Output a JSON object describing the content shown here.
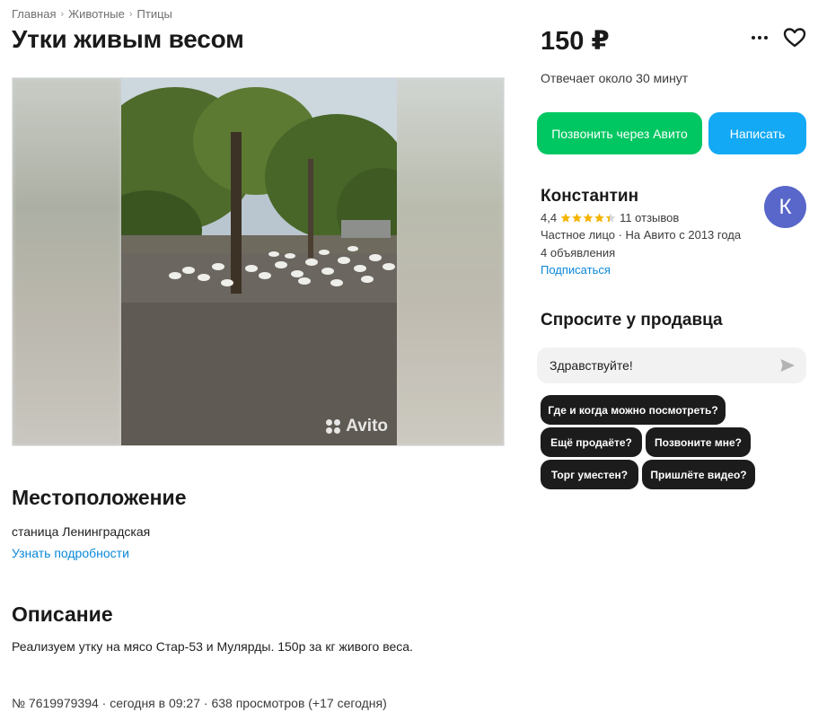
{
  "breadcrumb": {
    "items": [
      "Главная",
      "Животные",
      "Птицы"
    ]
  },
  "title": "Утки живым весом",
  "gallery": {
    "watermark": "Avito"
  },
  "location": {
    "heading": "Местоположение",
    "address": "станица Ленинградская",
    "details_link": "Узнать подробности"
  },
  "description": {
    "heading": "Описание",
    "text": "Реализуем утку на мясо Стар-53 и Мулярды. 150р за кг живого веса."
  },
  "meta": "№ 7619979394 · сегодня в 09:27 · 638 просмотров (+17 сегодня)",
  "price": "150 ₽",
  "responds": "Отвечает около 30 минут",
  "actions": {
    "call": "Позвонить через Авито",
    "message": "Написать"
  },
  "seller": {
    "name": "Константин",
    "rating": "4,4",
    "rating_value": 4.4,
    "reviews": "11 отзывов",
    "type": "Частное лицо · На Авито с 2013 года",
    "ads": "4 объявления",
    "subscribe": "Подписаться",
    "avatar_letter": "К",
    "avatar_color": "#5867c9"
  },
  "ask": {
    "heading": "Спросите у продавца",
    "input_value": "Здравствуйте!",
    "chips": [
      "Где и когда можно посмотреть?",
      "Ещё продаёте?",
      "Позвоните мне?",
      "Торг уместен?",
      "Пришлёте видео?"
    ]
  },
  "colors": {
    "call_button": "#00c761",
    "message_button": "#13a9f5",
    "link": "#0a88d9",
    "star": "#f4b400"
  }
}
